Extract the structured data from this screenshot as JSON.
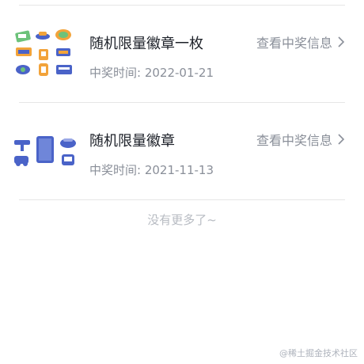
{
  "prizes": [
    {
      "title": "随机限量徽章一枚",
      "date_label": "中奖时间: 2022-01-21",
      "action_label": "查看中奖信息"
    },
    {
      "title": "随机限量徽章",
      "date_label": "中奖时间: 2021-11-13",
      "action_label": "查看中奖信息"
    }
  ],
  "footer": {
    "end_text": "没有更多了~"
  },
  "watermark": "@稀土掘金技术社区",
  "colors": {
    "title": "#1d2129",
    "secondary": "#8a8f99",
    "divider": "#e6e6e6",
    "badge_blue": "#4a63c8",
    "badge_orange": "#f2a33a",
    "badge_green": "#6cc27a"
  },
  "icons": [
    "badge-collage-icon",
    "chevron-right-icon"
  ]
}
